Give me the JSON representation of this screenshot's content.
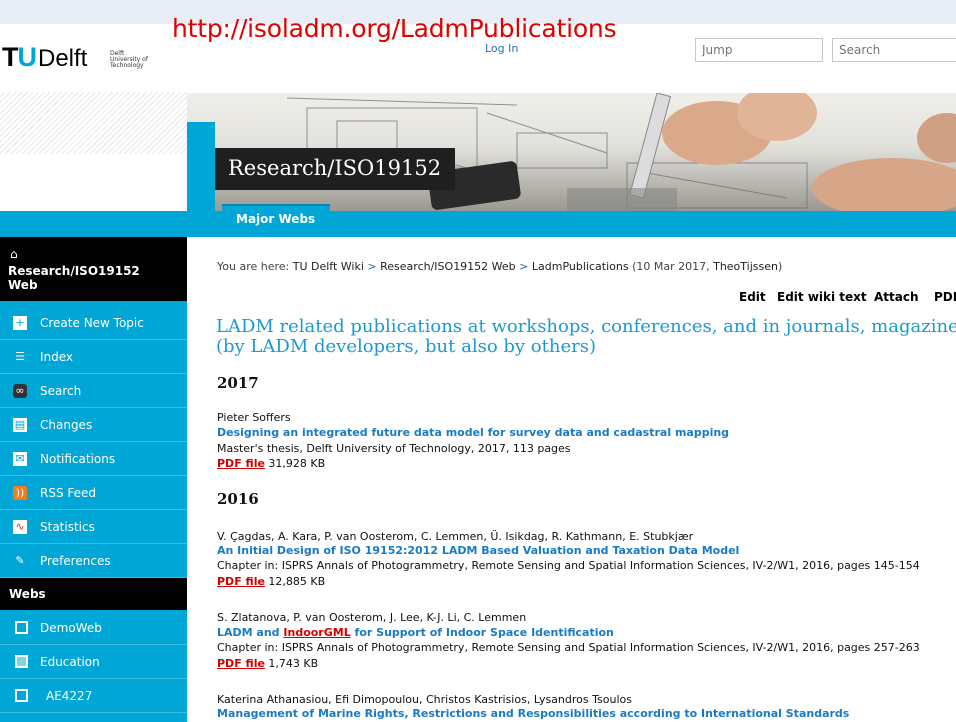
{
  "banner_url": "http://isoladm.org/LadmPublications",
  "header": {
    "login": "Log In",
    "jump_placeholder": "Jump",
    "search_placeholder": "Search",
    "logo": {
      "tu": "T",
      "u": "U",
      "delft": "Delft",
      "small_lines": [
        "Delft",
        "University of",
        "Technology"
      ]
    }
  },
  "hero": {
    "title": "Research/ISO19152"
  },
  "tabs": {
    "major_webs": "Major Webs"
  },
  "sidebar": {
    "web_title": "Research/ISO19152 Web",
    "items": [
      {
        "label": "Create New Topic",
        "icon": "page-add-icon"
      },
      {
        "label": "Index",
        "icon": "index-list-icon"
      },
      {
        "label": "Search",
        "icon": "binoculars-icon"
      },
      {
        "label": "Changes",
        "icon": "changes-icon"
      },
      {
        "label": "Notifications",
        "icon": "mail-icon"
      },
      {
        "label": "RSS Feed",
        "icon": "rss-icon"
      },
      {
        "label": "Statistics",
        "icon": "chart-icon"
      },
      {
        "label": "Preferences",
        "icon": "wrench-icon"
      }
    ],
    "webs_heading": "Webs",
    "webs": [
      "DemoWeb",
      "Education",
      "AE4227"
    ]
  },
  "breadcrumb": {
    "prefix": "You are here:",
    "items": [
      "TU Delft Wiki",
      "Research/ISO19152 Web",
      "LadmPublications"
    ],
    "date": "(10 Mar 2017,",
    "author": "TheoTijssen",
    "close": ")"
  },
  "actions": {
    "edit": "Edit",
    "edit_wiki": "Edit wiki text",
    "attach": "Attach",
    "pdf": "PDF"
  },
  "main": {
    "title_line1": "LADM related publications at workshops, conferences, and in journals, magazines",
    "title_line2": "(by LADM developers, but also by others)",
    "year_2017": "2017",
    "year_2016": "2016",
    "pubs": [
      {
        "authors": "Pieter Soffers",
        "title": "Designing an integrated future data model for survey data and cadastral mapping",
        "detail": "Master's thesis, Delft University of Technology, 2017, 113 pages",
        "pdf": "PDF file",
        "size": "31,928 KB"
      },
      {
        "authors": "V. Çagdas, A. Kara, P. van Oosterom, C. Lemmen, Ü. Isikdag, R. Kathmann, E. Stubkjær",
        "title": "An Initial Design of ISO 19152:2012 LADM Based Valuation and Taxation Data Model",
        "detail": "Chapter in: ISPRS Annals of Photogrammetry, Remote Sensing and Spatial Information Sciences, IV-2/W1, 2016, pages 145-154",
        "pdf": "PDF file",
        "size": "12,885 KB"
      },
      {
        "authors": "S. Zlatanova, P. van Oosterom, J. Lee, K-J. Li, C. Lemmen",
        "title_a": "LADM and ",
        "title_red": "IndoorGML",
        "title_b": " for Support of Indoor Space Identification",
        "detail": "Chapter in: ISPRS Annals of Photogrammetry, Remote Sensing and Spatial Information Sciences, IV-2/W1, 2016, pages 257-263",
        "pdf": "PDF file",
        "size": "1,743 KB"
      },
      {
        "authors": "Katerina Athanasiou, Efi Dimopoulou, Christos Kastrisios, Lysandros Tsoulos",
        "title": "Management of Marine Rights, Restrictions and Responsibilities according to International Standards"
      }
    ]
  }
}
